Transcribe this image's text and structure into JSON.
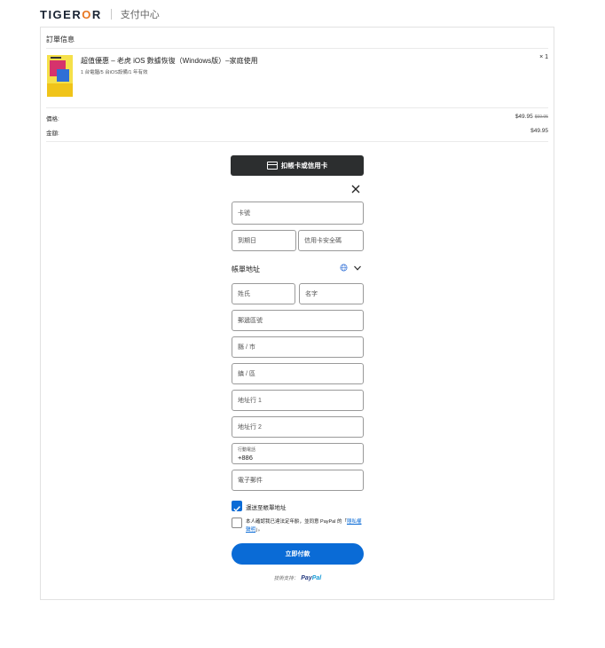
{
  "header": {
    "brand_prefix": "TIGER",
    "brand_o": "O",
    "brand_suffix": "R",
    "subtitle": "支付中心"
  },
  "order": {
    "title": "訂單信息",
    "product": {
      "name": "超值優惠 – 老虎 iOS 數據恢復（Windows版）–家庭使用",
      "subtitle": "1 台電腦/5 台iOS設備/1 年有效",
      "quantity": "× 1"
    },
    "price_label": "價格:",
    "price_value": "$49.95",
    "price_original": "$69.95",
    "total_label": "金額:",
    "total_value": "$49.95"
  },
  "payment": {
    "method_label": "扣帳卡或信用卡",
    "card_number_placeholder": "卡號",
    "expiry_placeholder": "到期日",
    "cvv_placeholder": "信用卡安全碼",
    "billing_title": "帳單地址",
    "first_name_placeholder": "姓氏",
    "last_name_placeholder": "名字",
    "postal_placeholder": "郵遞區號",
    "city_placeholder": "縣 / 市",
    "district_placeholder": "鎮 / 區",
    "address1_placeholder": "地址行 1",
    "address2_placeholder": "地址行 2",
    "phone_label": "行動電話",
    "phone_value": "+886",
    "email_placeholder": "電子郵件",
    "ship_to_billing_label": "運送至帳單地址",
    "ship_to_billing_checked": true,
    "terms_text_before": "本人確認我已達法定年齡，並同意 PayPal 的「",
    "terms_link": "隱私權聲明",
    "terms_text_after": "」。",
    "terms_checked": false,
    "pay_button": "立即付款",
    "powered_by": "技術支持：",
    "paypal_pay": "Pay",
    "paypal_pal": "Pal"
  },
  "colors": {
    "accent": "#0a6bd6",
    "dark_button": "#2c2e2f",
    "brand_o": "#e87722"
  },
  "icons": [
    "credit-card-icon",
    "close-icon",
    "globe-icon",
    "chevron-down-icon",
    "checkmark-icon"
  ]
}
